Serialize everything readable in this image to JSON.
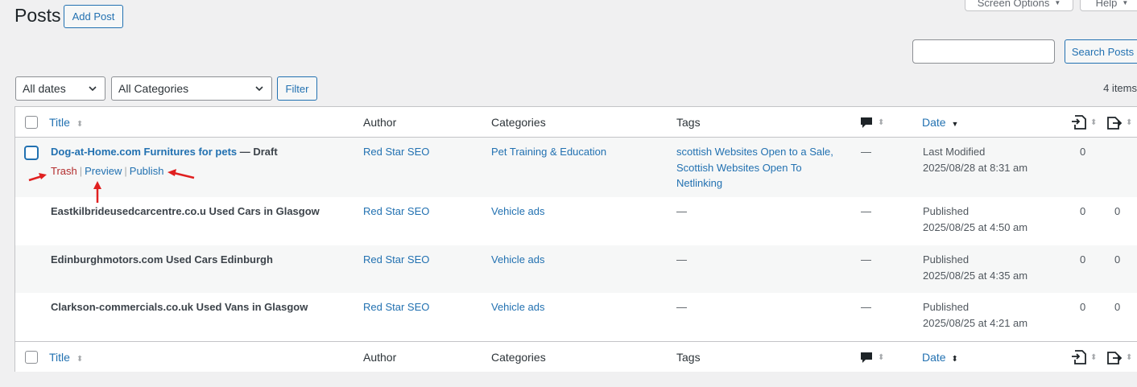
{
  "header": {
    "title": "Posts",
    "add_label": "Add Post",
    "screen_options_label": "Screen Options",
    "help_label": "Help"
  },
  "search": {
    "button_label": "Search Posts",
    "value": ""
  },
  "filters": {
    "date_selected": "All dates",
    "category_selected": "All Categories",
    "filter_label": "Filter",
    "items_count": "4 items"
  },
  "columns": {
    "title": "Title",
    "author": "Author",
    "categories": "Categories",
    "tags": "Tags",
    "date": "Date"
  },
  "rows": [
    {
      "title": "Dog-at-Home.com Furnitures for pets",
      "state": " — Draft",
      "author": "Red Star SEO",
      "category": "Pet Training & Education",
      "tags_line1": "scottish Websites Open to a Sale,",
      "tags_line2": "Scottish Websites Open To",
      "tags_line3": "Netlinking",
      "comments": "—",
      "date_status": "Last Modified",
      "date_value": "2025/08/28 at 8:31 am",
      "count1": "0",
      "count2": "",
      "actions": {
        "trash": "Trash",
        "preview": "Preview",
        "publish": "Publish",
        "separator": "|"
      }
    },
    {
      "title": "Eastkilbrideusedcarcentre.co.u Used Cars in Glasgow",
      "author": "Red Star SEO",
      "category": "Vehicle ads",
      "tags": "—",
      "comments": "—",
      "date_status": "Published",
      "date_value": "2025/08/25 at 4:50 am",
      "count1": "0",
      "count2": "0"
    },
    {
      "title": "Edinburghmotors.com Used Cars Edinburgh",
      "author": "Red Star SEO",
      "category": "Vehicle ads",
      "tags": "—",
      "comments": "—",
      "date_status": "Published",
      "date_value": "2025/08/25 at 4:35 am",
      "count1": "0",
      "count2": "0"
    },
    {
      "title": "Clarkson-commercials.co.uk Used Vans in Glasgow",
      "author": "Red Star SEO",
      "category": "Vehicle ads",
      "tags": "—",
      "comments": "—",
      "date_status": "Published",
      "date_value": "2025/08/25 at 4:21 am",
      "count1": "0",
      "count2": "0"
    }
  ],
  "colors": {
    "link": "#2271b1",
    "trash": "#b32d2e",
    "annotation_arrow": "#e02020"
  }
}
